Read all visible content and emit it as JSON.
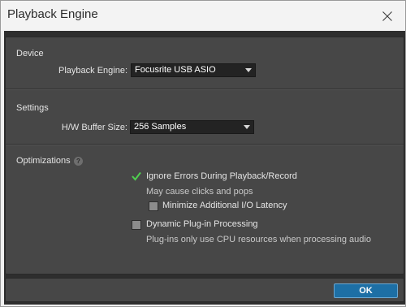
{
  "window": {
    "title": "Playback Engine"
  },
  "device": {
    "section_label": "Device",
    "playback_engine_label": "Playback Engine:",
    "playback_engine_value": "Focusrite USB ASIO"
  },
  "settings": {
    "section_label": "Settings",
    "buffer_label": "H/W Buffer Size:",
    "buffer_value": "256 Samples"
  },
  "optimizations": {
    "section_label": "Optimizations",
    "help_glyph": "?",
    "ignore_errors": {
      "label": "Ignore Errors During Playback/Record",
      "checked": true,
      "note": "May cause clicks and pops"
    },
    "minimize_latency": {
      "label": "Minimize Additional I/O Latency",
      "checked": false
    },
    "dynamic_plugin": {
      "label": "Dynamic Plug-in Processing",
      "checked": false,
      "note": "Plug-ins only use CPU resources when processing audio"
    }
  },
  "footer": {
    "ok_label": "OK"
  },
  "colors": {
    "accent": "#1d6fa5",
    "check": "#4fcf4f"
  },
  "icons": {
    "close": "close-icon",
    "help": "help-icon",
    "dropdown": "chevron-down-icon",
    "check": "checkmark-icon"
  }
}
